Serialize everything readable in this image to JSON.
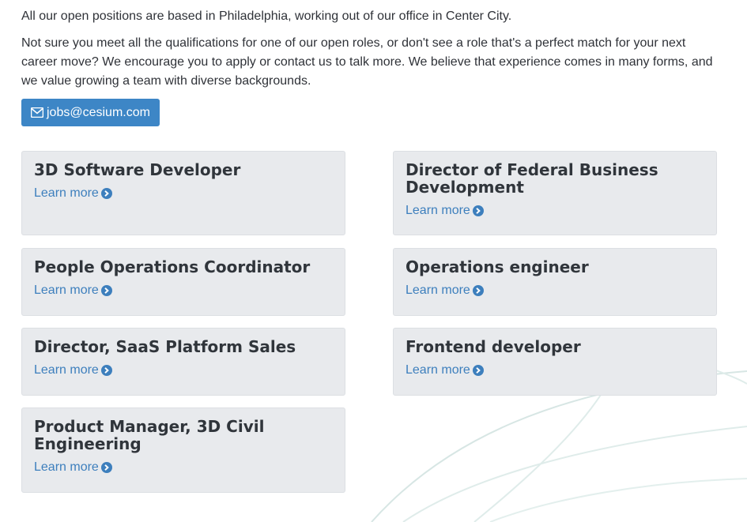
{
  "intro": {
    "location_text": "All our open positions are based in Philadelphia, working out of our office in Center City.",
    "encourage_text": "Not sure you meet all the qualifications for one of our open roles, or don't see a role that's a perfect match for your next career move? We encourage you to apply or contact us to talk more. We believe that experience comes in many forms, and we value growing a team with diverse backgrounds."
  },
  "contact": {
    "email_label": "jobs@cesium.com",
    "icon": "envelope-icon"
  },
  "colors": {
    "accent": "#3d86c6",
    "link": "#3d7fbd",
    "card_bg": "#e8eaed",
    "title_text": "#30353b"
  },
  "positions": [
    {
      "title": "3D Software Developer",
      "link_label": "Learn more"
    },
    {
      "title": "Director of Federal Business Development",
      "link_label": "Learn more"
    },
    {
      "title": "People Operations Coordinator",
      "link_label": "Learn more"
    },
    {
      "title": "Operations engineer",
      "link_label": "Learn more"
    },
    {
      "title": "Director, SaaS Platform Sales",
      "link_label": "Learn more"
    },
    {
      "title": "Frontend developer",
      "link_label": "Learn more"
    },
    {
      "title": "Product Manager, 3D Civil Engineering",
      "link_label": "Learn more"
    }
  ]
}
